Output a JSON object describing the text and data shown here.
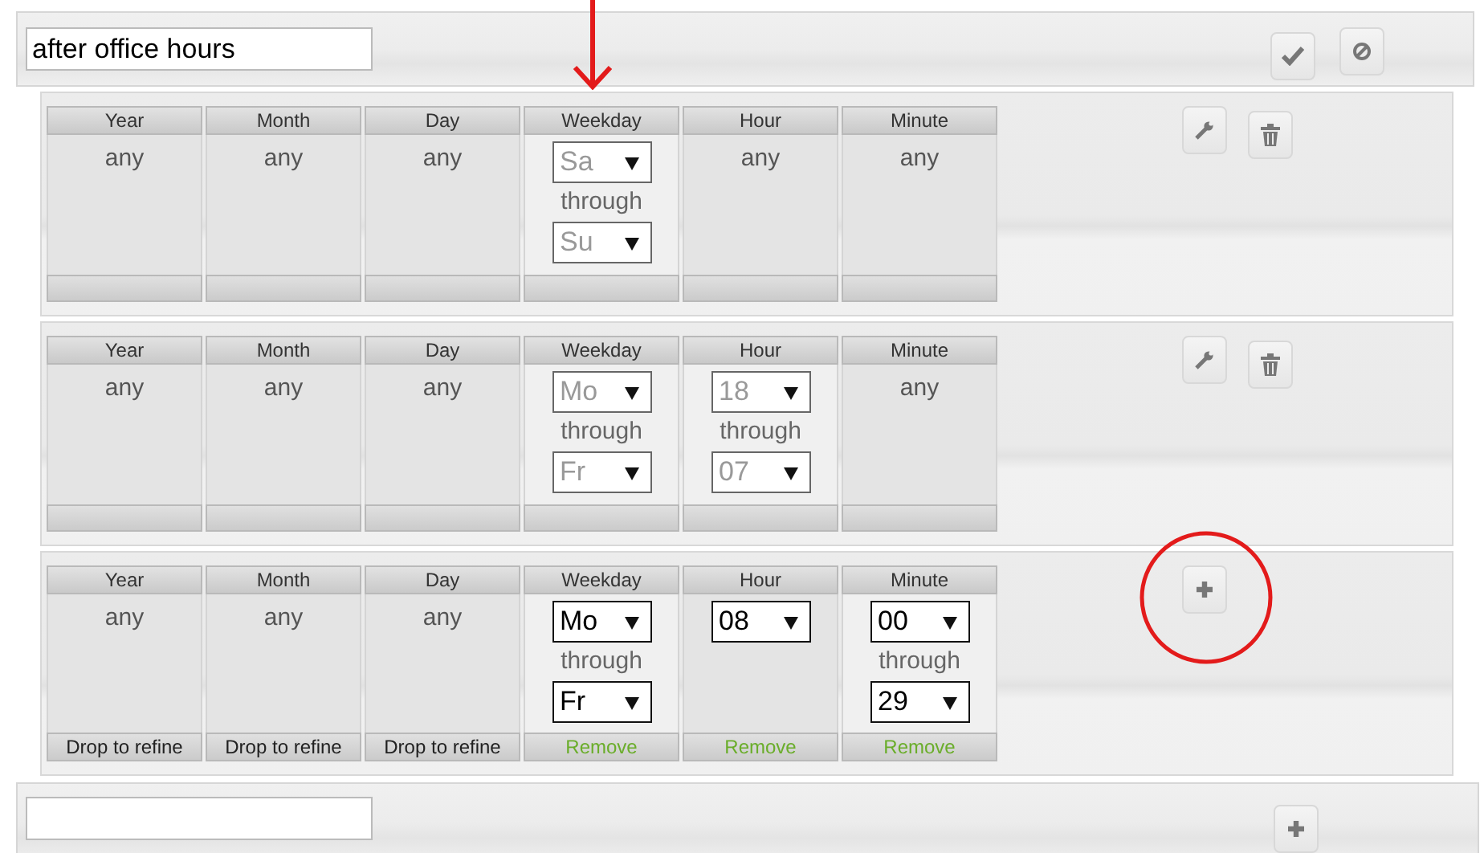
{
  "name_field": {
    "value": "after office hours"
  },
  "header_actions": [
    {
      "kind": "confirm"
    },
    {
      "kind": "cancel"
    }
  ],
  "rules": [
    {
      "actions": [
        {
          "kind": "edit"
        },
        {
          "kind": "delete"
        }
      ],
      "columns": [
        {
          "header": "Year",
          "kind": "any",
          "value": "any"
        },
        {
          "header": "Month",
          "kind": "any",
          "value": "any"
        },
        {
          "header": "Day",
          "kind": "any",
          "value": "any"
        },
        {
          "header": "Weekday",
          "kind": "range",
          "from": "Sa",
          "through": "through",
          "to": "Su",
          "disabled": true
        },
        {
          "header": "Hour",
          "kind": "any",
          "value": "any"
        },
        {
          "header": "Minute",
          "kind": "any",
          "value": "any"
        }
      ]
    },
    {
      "actions": [
        {
          "kind": "edit"
        },
        {
          "kind": "delete"
        }
      ],
      "columns": [
        {
          "header": "Year",
          "kind": "any",
          "value": "any"
        },
        {
          "header": "Month",
          "kind": "any",
          "value": "any"
        },
        {
          "header": "Day",
          "kind": "any",
          "value": "any"
        },
        {
          "header": "Weekday",
          "kind": "range",
          "from": "Mo",
          "through": "through",
          "to": "Fr",
          "disabled": true
        },
        {
          "header": "Hour",
          "kind": "range",
          "from": "18",
          "through": "through",
          "to": "07",
          "disabled": true
        },
        {
          "header": "Minute",
          "kind": "any",
          "value": "any"
        }
      ]
    },
    {
      "actions": [
        {
          "kind": "add"
        }
      ],
      "columns": [
        {
          "header": "Year",
          "kind": "any",
          "value": "any",
          "footer": {
            "kind": "refine",
            "text": "Drop to refine"
          }
        },
        {
          "header": "Month",
          "kind": "any",
          "value": "any",
          "footer": {
            "kind": "refine",
            "text": "Drop to refine"
          }
        },
        {
          "header": "Day",
          "kind": "any",
          "value": "any",
          "footer": {
            "kind": "refine",
            "text": "Drop to refine"
          }
        },
        {
          "header": "Weekday",
          "kind": "range",
          "from": "Mo",
          "through": "through",
          "to": "Fr",
          "disabled": false,
          "footer": {
            "kind": "remove",
            "text": "Remove"
          }
        },
        {
          "header": "Hour",
          "kind": "single",
          "from": "08",
          "disabled": false,
          "footer": {
            "kind": "remove",
            "text": "Remove"
          }
        },
        {
          "header": "Minute",
          "kind": "range",
          "from": "00",
          "through": "through",
          "to": "29",
          "disabled": false,
          "footer": {
            "kind": "remove",
            "text": "Remove"
          }
        }
      ]
    }
  ],
  "new_item": {
    "actions": [
      {
        "kind": "add"
      }
    ]
  }
}
